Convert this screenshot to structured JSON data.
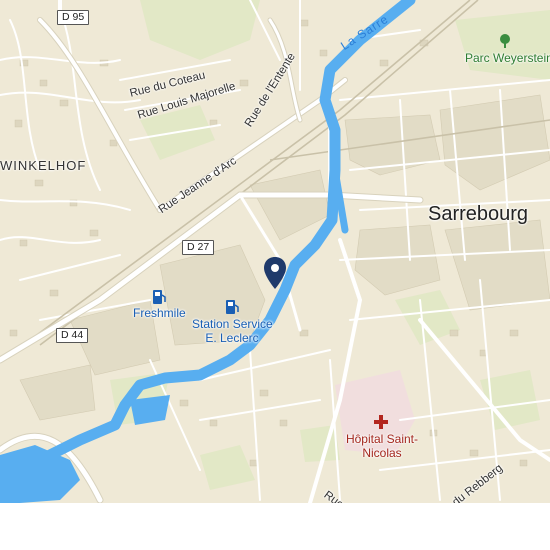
{
  "map": {
    "town_label": "Sarrebourg",
    "district_label": "WINKELHOF",
    "river_label": "La Sarre",
    "roads": [
      {
        "id": "d95",
        "label": "D 95"
      },
      {
        "id": "d27",
        "label": "D 27"
      },
      {
        "id": "d44",
        "label": "D 44"
      }
    ],
    "streets": [
      {
        "id": "coteau",
        "label": "Rue du Coteau"
      },
      {
        "id": "majorelle",
        "label": "Rue Louis Majorelle"
      },
      {
        "id": "entente",
        "label": "Rue de l'Entente"
      },
      {
        "id": "jeanne",
        "label": "Rue Jeanne d'Arc"
      },
      {
        "id": "rebberg",
        "label": "du Rebberg"
      },
      {
        "id": "rue-d",
        "label": "Rue d"
      }
    ],
    "pois": [
      {
        "id": "freshmile",
        "label": "Freshmile",
        "icon": "ev-charging-icon"
      },
      {
        "id": "station",
        "label_line1": "Station Service",
        "label_line2": "E. Leclerc",
        "icon": "fuel-pump-icon"
      },
      {
        "id": "hopital",
        "label_line1": "Hôpital Saint-",
        "label_line2": "Nicolas",
        "icon": "hospital-cross-icon"
      },
      {
        "id": "parc",
        "label": "Parc Weyerstein",
        "icon": "tree-icon"
      }
    ],
    "colors": {
      "land": "#efe9d6",
      "water": "#58aef0",
      "poi_blue": "#1a5fb4",
      "poi_red": "#a4281e",
      "poi_green": "#2e7d32",
      "pin": "#1f3a6b",
      "park": "#dfe8c4"
    }
  }
}
